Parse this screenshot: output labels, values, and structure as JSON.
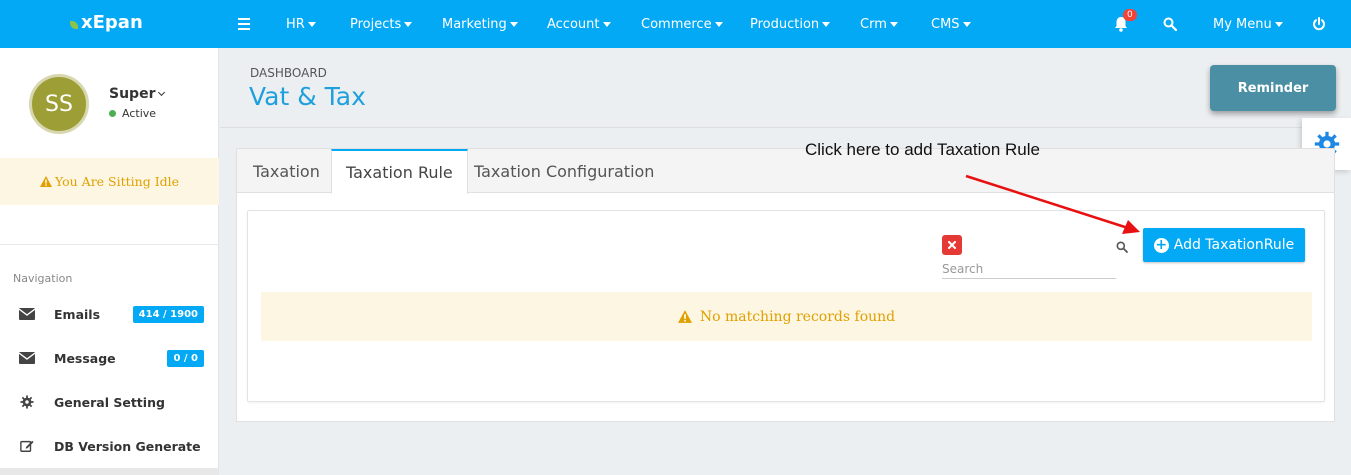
{
  "topbar": {
    "brand": "xEpan",
    "menu": [
      {
        "label": "HR"
      },
      {
        "label": "Projects"
      },
      {
        "label": "Marketing"
      },
      {
        "label": "Account"
      },
      {
        "label": "Commerce"
      },
      {
        "label": "Production"
      },
      {
        "label": "Crm"
      },
      {
        "label": "CMS"
      }
    ],
    "notification_count": "0",
    "my_menu_label": "My Menu",
    "icons": [
      "menu-icon",
      "bell-icon",
      "search-icon",
      "power-icon"
    ]
  },
  "sidebar": {
    "avatar_initials": "SS",
    "user_name": "Super",
    "user_status": "Active",
    "idle_message": "You Are Sitting Idle",
    "nav_title": "Navigation",
    "items": [
      {
        "label": "Emails",
        "count": "414 / 1900",
        "icon": "envelope-icon"
      },
      {
        "label": "Message",
        "count": "0 / 0",
        "icon": "envelope-icon"
      },
      {
        "label": "General Setting",
        "icon": "gear-icon"
      },
      {
        "label": "DB Version Generate",
        "icon": "edit-icon"
      }
    ]
  },
  "header": {
    "breadcrumb": "DASHBOARD",
    "title": "Vat & Tax",
    "reminder_label": "Reminder"
  },
  "tabs": [
    {
      "label": "Taxation",
      "active": false
    },
    {
      "label": "Taxation Rule",
      "active": true
    },
    {
      "label": "Taxation Configuration",
      "active": false
    }
  ],
  "grid": {
    "search_placeholder": "Search",
    "search_value": "",
    "add_button_label": "Add TaxationRule",
    "empty_message": "No matching records found"
  },
  "annotation": {
    "text": "Click here to add Taxation Rule"
  },
  "colors": {
    "primary": "#03a9f4",
    "title_blue": "#1ea0dc",
    "warning_bg": "#fdf6e3",
    "warning_text": "#e0a000",
    "danger": "#e53935",
    "reminder": "#4a8fa3",
    "annotation_arrow": "#e81010"
  }
}
